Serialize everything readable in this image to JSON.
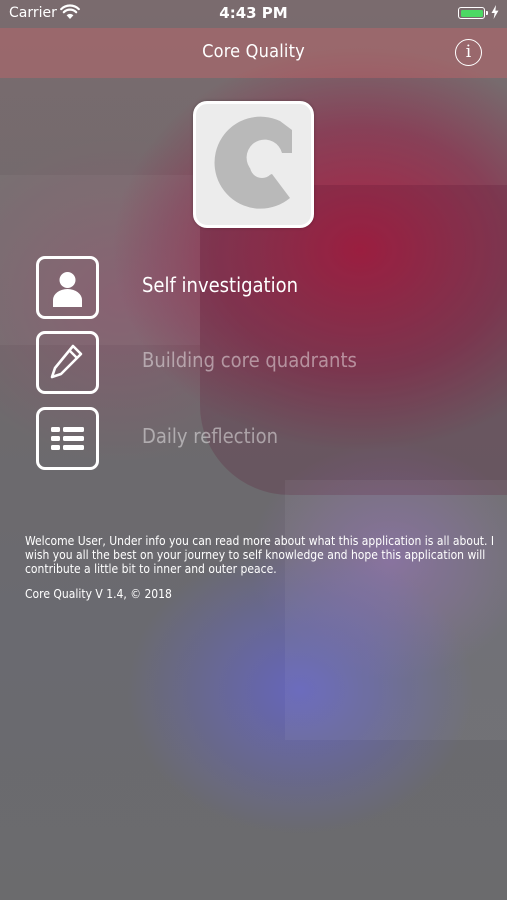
{
  "status_bar": {
    "carrier": "Carrier",
    "time": "4:43 PM",
    "wifi_icon": "wifi-icon",
    "battery_icon": "battery-icon",
    "battery_color": "#4cd964"
  },
  "nav": {
    "title": "Core Quality",
    "info_label": "i",
    "info_icon": "info-icon"
  },
  "logo": {
    "icon": "core-quality-logo",
    "color": "#b9b9b9"
  },
  "menu": {
    "items": [
      {
        "label": "Self investigation",
        "icon": "person-icon",
        "active": true
      },
      {
        "label": "Building core quadrants",
        "icon": "pencil-icon",
        "active": false
      },
      {
        "label": "Daily reflection",
        "icon": "list-icon",
        "active": false
      }
    ]
  },
  "footer": {
    "welcome": "Welcome User, Under info you can read more about what this application is all about. I wish you all the best on your journey to self knowledge and hope this application will contribute a little bit to inner and outer peace.",
    "version": "Core Quality V 1.4, © 2018"
  },
  "colors": {
    "nav_bar": "#c8646a",
    "accent_red": "#b01e42",
    "accent_blue": "#6464cd"
  }
}
